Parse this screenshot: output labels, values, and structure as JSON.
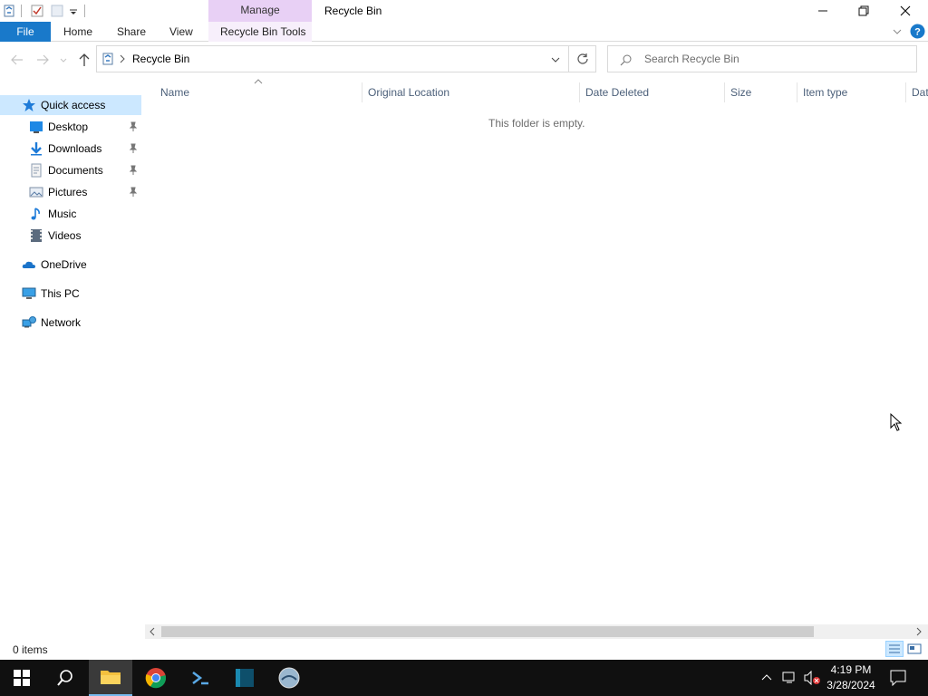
{
  "window": {
    "title": "Recycle Bin",
    "contextual_group": "Manage",
    "controls": [
      "minimize",
      "restore",
      "close"
    ]
  },
  "ribbon": {
    "file_tab": "File",
    "tabs": [
      "Home",
      "Share",
      "View",
      "Recycle Bin Tools"
    ]
  },
  "address": {
    "path_label": "Recycle Bin",
    "search_placeholder": "Search Recycle Bin"
  },
  "nav": {
    "quick_access": "Quick access",
    "pinned": [
      {
        "label": "Desktop",
        "icon": "desktop-icon"
      },
      {
        "label": "Downloads",
        "icon": "downloads-icon"
      },
      {
        "label": "Documents",
        "icon": "documents-icon"
      },
      {
        "label": "Pictures",
        "icon": "pictures-icon"
      }
    ],
    "unpinned": [
      {
        "label": "Music",
        "icon": "music-icon"
      },
      {
        "label": "Videos",
        "icon": "videos-icon"
      }
    ],
    "onedrive": "OneDrive",
    "this_pc": "This PC",
    "network": "Network"
  },
  "columns": [
    "Name",
    "Original Location",
    "Date Deleted",
    "Size",
    "Item type",
    "Dat"
  ],
  "empty_message": "This folder is empty.",
  "status": {
    "item_count": "0 items"
  },
  "taskbar": {
    "apps": [
      "start",
      "search",
      "file-explorer",
      "chrome",
      "powershell",
      "terminal",
      "browser-globe"
    ],
    "time": "4:19 PM",
    "date": "3/28/2024"
  },
  "colors": {
    "accent": "#1979ca",
    "manage_tab": "#e8d0f5",
    "selected_nav": "#cce8ff",
    "taskbar": "#101010"
  }
}
